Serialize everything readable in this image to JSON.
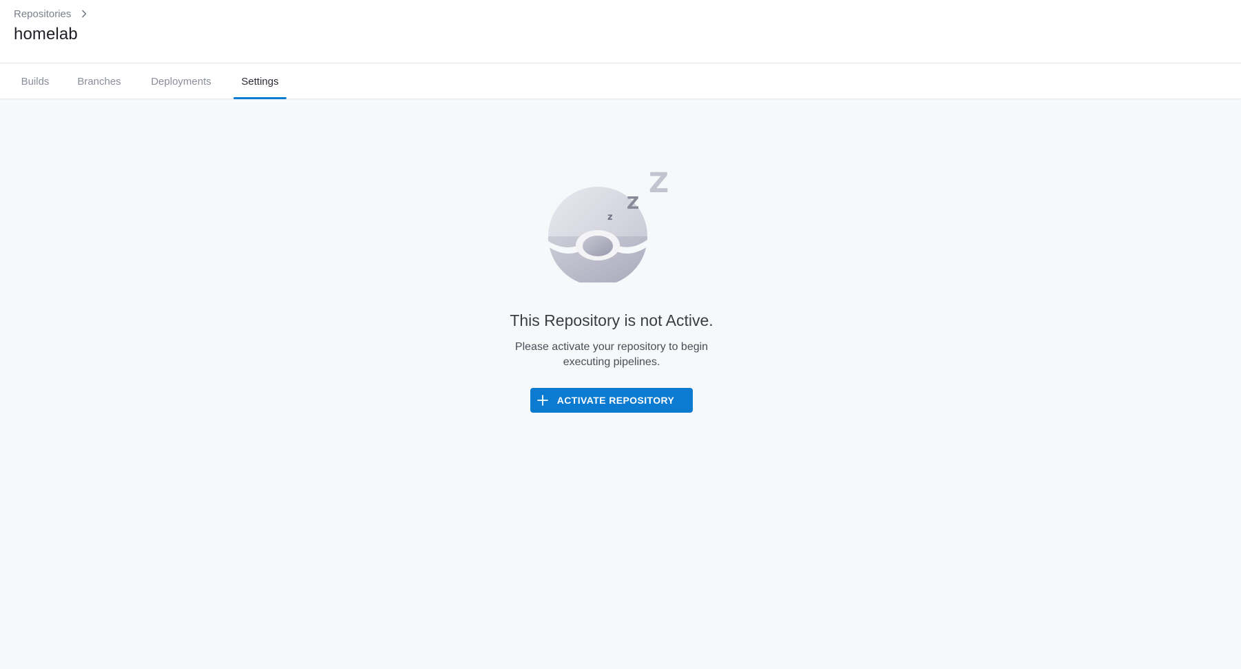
{
  "header": {
    "breadcrumb": {
      "parent_label": "Repositories",
      "separator_icon": "chevron-right-icon"
    },
    "title": "homelab"
  },
  "tabs": [
    {
      "label": "Builds",
      "active": false
    },
    {
      "label": "Branches",
      "active": false
    },
    {
      "label": "Deployments",
      "active": false
    },
    {
      "label": "Settings",
      "active": true
    }
  ],
  "empty_state": {
    "illustration_icon": "sleeping-ball-icon",
    "title": "This Repository is not Active.",
    "description": "Please activate your repository to begin executing pipelines.",
    "button": {
      "label": "ACTIVATE REPOSITORY",
      "icon": "plus-icon"
    }
  },
  "colors": {
    "accent": "#0b7ad1",
    "background": "#f7f8fa",
    "header_background": "#ffffff",
    "muted_text": "#8a8e99"
  }
}
